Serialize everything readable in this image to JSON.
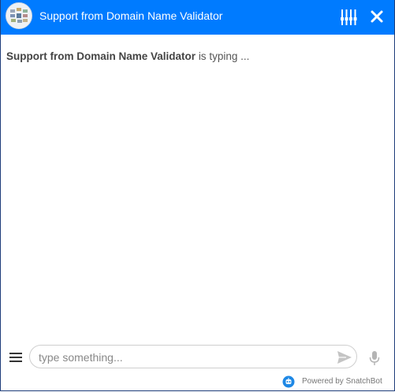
{
  "header": {
    "title": "Support from Domain Name Validator",
    "avatar_icon": "domain-validator-logo",
    "settings_icon": "settings-sliders-icon",
    "close_icon": "close-icon",
    "background_color": "#007bff"
  },
  "chat": {
    "typing_agent": "Support from Domain Name Validator",
    "typing_suffix": "is typing ..."
  },
  "composer": {
    "menu_icon": "menu-icon",
    "placeholder": "type something...",
    "value": "",
    "send_icon": "send-icon",
    "mic_icon": "microphone-icon"
  },
  "footer": {
    "powered_by": "Powered by SnatchBot",
    "logo_icon": "snatchbot-logo-icon"
  }
}
